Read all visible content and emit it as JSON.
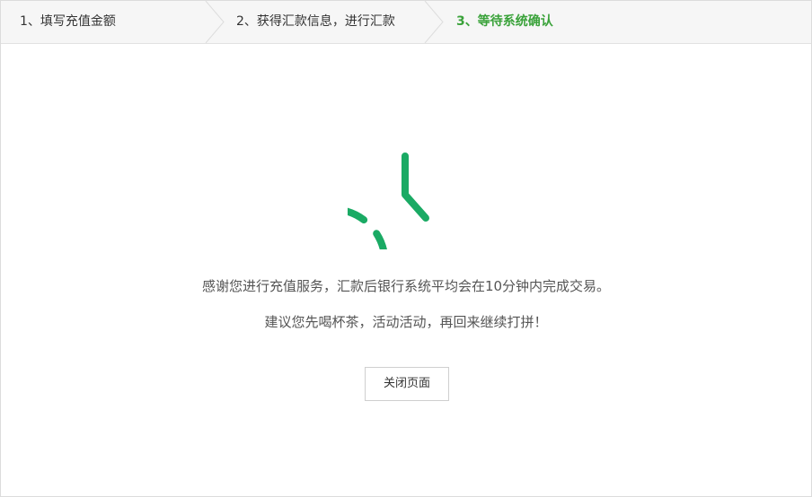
{
  "steps": [
    {
      "label": "1、填写充值金额",
      "state": "done"
    },
    {
      "label": "2、获得汇款信息，进行汇款",
      "state": "done"
    },
    {
      "label": "3、等待系统确认",
      "state": "active"
    }
  ],
  "colors": {
    "accent": "#3aa23a",
    "clock": "#1aaa64",
    "step_bar_bg": "#f6f6f6"
  },
  "status_icon": "clock-icon",
  "message": {
    "line1": "感谢您进行充值服务，汇款后银行系统平均会在10分钟内完成交易。",
    "line2": "建议您先喝杯茶，活动活动，再回来继续打拼！"
  },
  "close_button": {
    "label": "关闭页面"
  }
}
